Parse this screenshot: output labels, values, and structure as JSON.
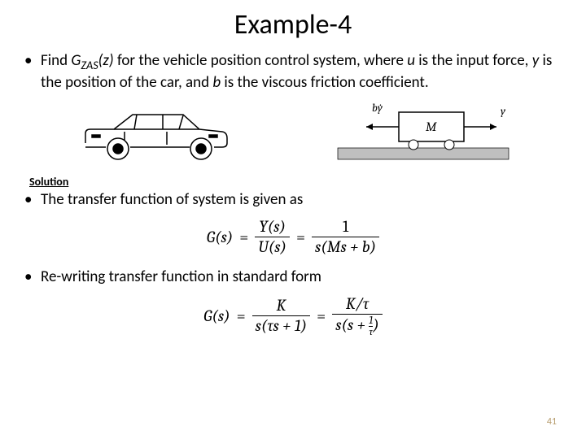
{
  "title": "Example-4",
  "problem": {
    "prefix": "Find ",
    "func": "G",
    "func_sub": "ZAS",
    "func_arg": "(z)",
    "mid1": " for the vehicle position control system, where ",
    "u": "u",
    "mid2": " is the input force, ",
    "y": "y",
    "mid3": " is the position of the car, and ",
    "b": "b",
    "mid4": " is the viscous friction coefficient."
  },
  "diagram": {
    "by_dot": "bẏ",
    "mass": "M",
    "y_label": "y"
  },
  "solution_label": "Solution",
  "bullet2": "The transfer function of system is given as",
  "eq1": {
    "lhs": "G(s)",
    "rhs1_num": "Y(s)",
    "rhs1_den": "U(s)",
    "rhs2_num": "1",
    "rhs2_den": "s(Ms + b)"
  },
  "bullet3": "Re-writing transfer function in standard form",
  "eq2": {
    "lhs": "G(s)",
    "rhs1_num": "K",
    "rhs1_den_pre": "s(τs + 1)",
    "rhs2_num": "K/τ",
    "rhs2_den_s": "s(s + ",
    "rhs2_mini_num": "1",
    "rhs2_mini_den": "τ",
    "rhs2_den_close": ")"
  },
  "pagenum": "41"
}
